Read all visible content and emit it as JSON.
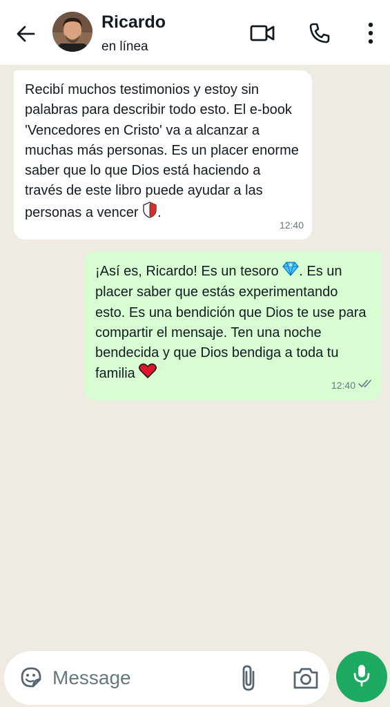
{
  "header": {
    "contact_name": "Ricardo",
    "status": "en línea",
    "icons": [
      "back-arrow-icon",
      "video-call-icon",
      "voice-call-icon",
      "more-options-icon"
    ]
  },
  "messages": [
    {
      "direction": "incoming",
      "text": "Recibí muchos testimonios y estoy sin palabras para describir todo esto. El e-book 'Vencedores en Cristo' va a alcanzar a muchas más personas. Es un placer enorme saber que lo que Dios está haciendo a través de este libro puede ayudar a las personas a vencer",
      "trailing_emoji": "shield-icon",
      "trailing_text": ".",
      "time": "12:40"
    },
    {
      "direction": "outgoing",
      "text_before_emoji": "¡Así es, Ricardo! Es un tesoro",
      "emoji_1": "gem-icon",
      "text_after_emoji": ". Es un placer saber que estás experimentando esto. Es una bendición que Dios te use para compartir el mensaje. Ten una noche bendecida y que Dios bendiga a toda tu familia",
      "emoji_2": "red-heart-icon",
      "time": "12:40",
      "status": "read-double-check-icon"
    }
  ],
  "composer": {
    "placeholder": "Message",
    "icons": [
      "sticker-icon",
      "attach-icon",
      "camera-icon",
      "microphone-icon"
    ]
  },
  "colors": {
    "chat_background": "#efeae2",
    "incoming_bubble": "#ffffff",
    "outgoing_bubble": "#d9fdd3",
    "mic_button": "#1daa61"
  }
}
